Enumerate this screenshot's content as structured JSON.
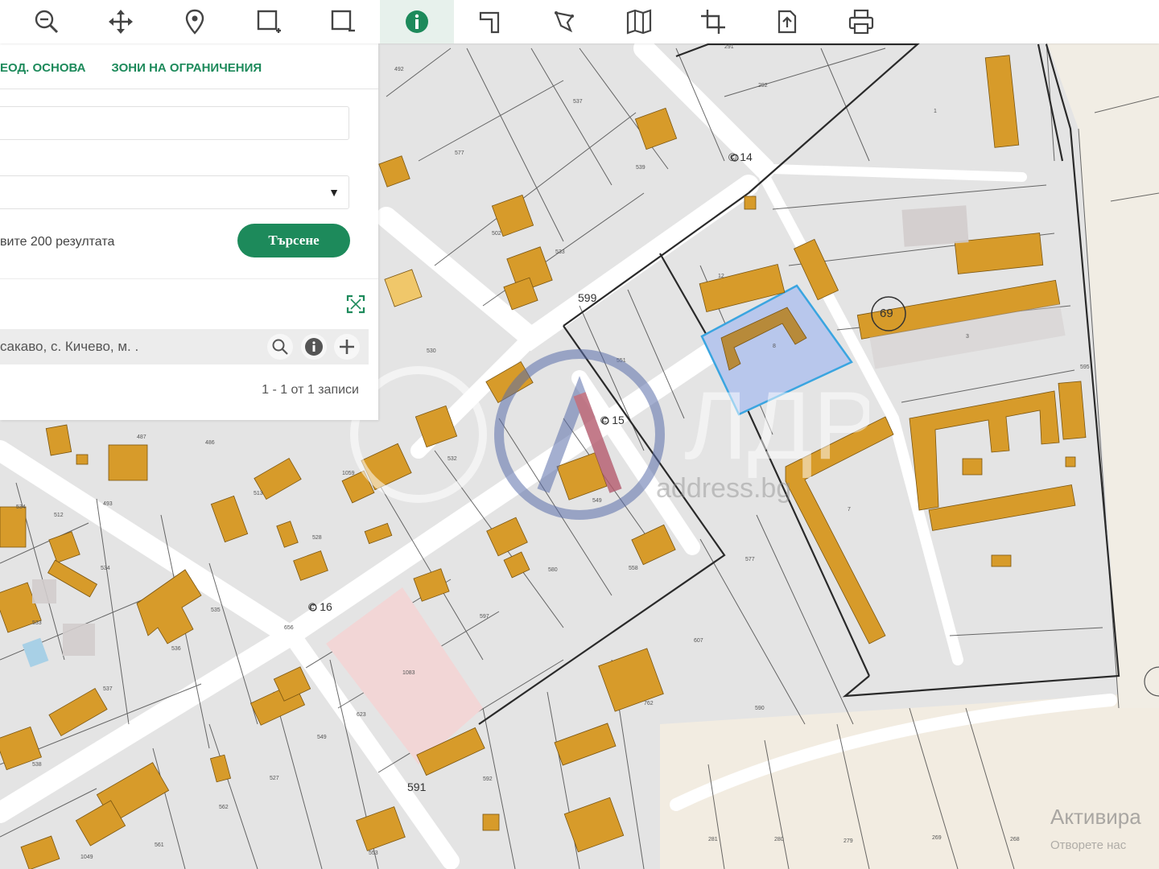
{
  "toolbar": {
    "tools": [
      {
        "name": "zoom-out-icon",
        "active": false
      },
      {
        "name": "pan-icon",
        "active": false
      },
      {
        "name": "location-pin-icon",
        "active": false
      },
      {
        "name": "select-area-add-icon",
        "active": false
      },
      {
        "name": "select-area-remove-icon",
        "active": false
      },
      {
        "name": "info-icon",
        "active": true
      },
      {
        "name": "measure-distance-icon",
        "active": false
      },
      {
        "name": "measure-area-icon",
        "active": false
      },
      {
        "name": "map-layers-icon",
        "active": false
      },
      {
        "name": "crop-icon",
        "active": false
      },
      {
        "name": "export-icon",
        "active": false
      },
      {
        "name": "print-icon",
        "active": false
      }
    ],
    "accent": "#1d8a5b"
  },
  "panel": {
    "tabs": [
      "ЕОД. ОСНОВА",
      "ЗОНИ НА ОГРАНИЧЕНИЯ"
    ],
    "text_field_value": "",
    "select_value": "",
    "hint": "вите 200 резултата",
    "search_label": "Търсене",
    "result_text": "сакаво, с. Кичево, м. .",
    "pager": "1 - 1 от 1 записи"
  },
  "map": {
    "road_labels": [
      "599",
      "591"
    ],
    "landmark_labels": [
      "© 14",
      "© 15",
      "© 16"
    ],
    "circle_label": "69",
    "watermark_text": "ЛДРЕС",
    "watermark_url": "address.bg"
  },
  "os_notice": {
    "title": "Активира",
    "subtitle": "Отворете нас"
  },
  "colors": {
    "building": "#d79b2a",
    "parcel": "#e3e3e3",
    "road": "#ffffff",
    "highlight": "#b9c9ee",
    "pink_parcel": "#f0d5d5",
    "border": "#2a2a2a"
  }
}
